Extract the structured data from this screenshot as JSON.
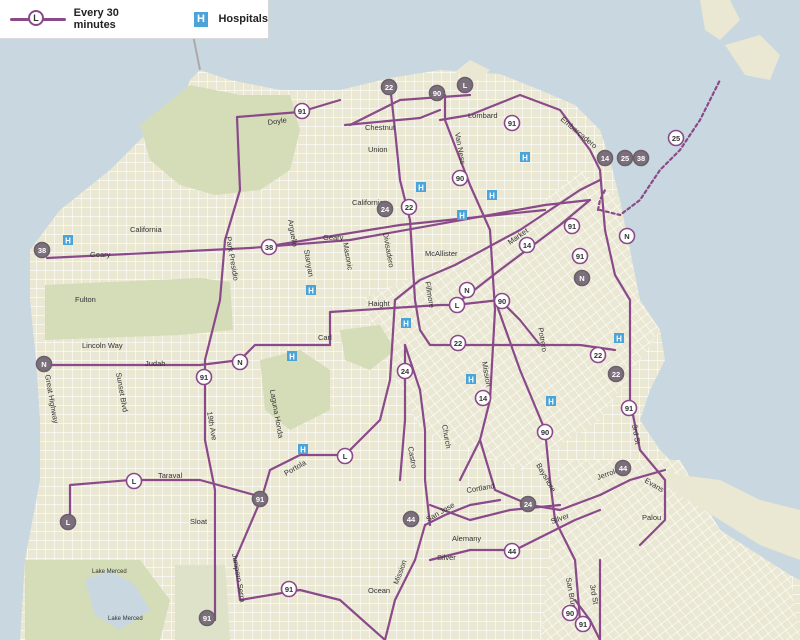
{
  "legend": {
    "route_badge": "L",
    "route_label": "Every 30 minutes",
    "hospital_icon": "H",
    "hospital_label": "Hospitals"
  },
  "colors": {
    "water": "#c9d8e0",
    "land": "#eae7d3",
    "park": "#d5dcb8",
    "street": "#ffffff",
    "route": "#8a4a8a",
    "hospital": "#4aa3d9"
  },
  "streets": {
    "doyle": "Doyle",
    "chestnut": "Chestnut",
    "lombard": "Lombard",
    "union": "Union",
    "embarcadero": "Embarcadero",
    "van_ness": "Van Ness",
    "california_w": "California",
    "california_e": "California",
    "geary_w": "Geary",
    "geary_e": "Geary",
    "arguello": "Arguello",
    "stanyan": "Stanyan",
    "masonic": "Masonic",
    "divisadero": "Divisadero",
    "mcallister": "McAllister",
    "market": "Market",
    "fulton": "Fulton",
    "park_presidio": "Park Presidio",
    "haight": "Haight",
    "fillmore": "Fillmore",
    "lincoln_way": "Lincoln Way",
    "carl": "Carl",
    "judah": "Judah",
    "potrero": "Potrero",
    "great_highway": "Great Highway",
    "sunset_blvd": "Sunset Blvd",
    "laguna_honda": "Laguna Honda",
    "nineteenth_ave": "19th Ave",
    "castro": "Castro",
    "church": "Church",
    "mission": "Mission",
    "third_st": "3rd St",
    "taraval": "Taraval",
    "portola": "Portola",
    "cortland": "Cortland",
    "bayshore": "Bayshore",
    "jerrold": "Jerrold",
    "evans": "Evans",
    "sloat": "Sloat",
    "san_jose": "San Jose",
    "alemany": "Alemany",
    "silver_w": "Silver",
    "silver_e": "Silver",
    "palou": "Palou",
    "lake_merced_top": "Lake Merced",
    "lake_merced_bottom": "Lake Merced",
    "junipero_serra": "Junipero Serra",
    "ocean": "Ocean",
    "mission_s": "Mission",
    "san_bruno": "San Bruno",
    "third_st_s": "3rd St"
  },
  "route_badges": [
    {
      "id": "22",
      "dark": true
    },
    {
      "id": "90",
      "dark": true
    },
    {
      "id": "L",
      "dark": true
    },
    {
      "id": "91",
      "dark": false
    },
    {
      "id": "91",
      "dark": false
    },
    {
      "id": "14",
      "dark": true
    },
    {
      "id": "25",
      "dark": true
    },
    {
      "id": "38",
      "dark": true
    },
    {
      "id": "25",
      "dark": false
    },
    {
      "id": "90",
      "dark": false
    },
    {
      "id": "24",
      "dark": true
    },
    {
      "id": "22",
      "dark": false
    },
    {
      "id": "91",
      "dark": false
    },
    {
      "id": "N",
      "dark": false
    },
    {
      "id": "38",
      "dark": true
    },
    {
      "id": "38",
      "dark": false
    },
    {
      "id": "14",
      "dark": false
    },
    {
      "id": "91",
      "dark": false
    },
    {
      "id": "N",
      "dark": true
    },
    {
      "id": "N",
      "dark": false
    },
    {
      "id": "90",
      "dark": false
    },
    {
      "id": "L",
      "dark": false
    },
    {
      "id": "22",
      "dark": false
    },
    {
      "id": "22",
      "dark": false
    },
    {
      "id": "N",
      "dark": true
    },
    {
      "id": "N",
      "dark": false
    },
    {
      "id": "22",
      "dark": true
    },
    {
      "id": "91",
      "dark": false
    },
    {
      "id": "24",
      "dark": false
    },
    {
      "id": "14",
      "dark": false
    },
    {
      "id": "91",
      "dark": false
    },
    {
      "id": "90",
      "dark": false
    },
    {
      "id": "L",
      "dark": false
    },
    {
      "id": "L",
      "dark": false
    },
    {
      "id": "91",
      "dark": true
    },
    {
      "id": "44",
      "dark": true
    },
    {
      "id": "24",
      "dark": true
    },
    {
      "id": "44",
      "dark": true
    },
    {
      "id": "L",
      "dark": true
    },
    {
      "id": "44",
      "dark": false
    },
    {
      "id": "91",
      "dark": false
    },
    {
      "id": "90",
      "dark": false
    },
    {
      "id": "91",
      "dark": false
    },
    {
      "id": "91",
      "dark": true
    }
  ]
}
